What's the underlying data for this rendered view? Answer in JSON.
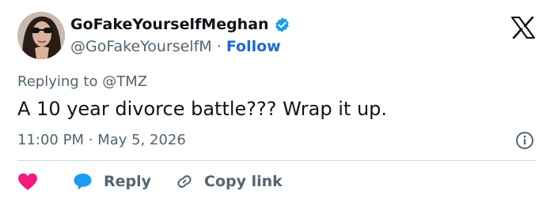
{
  "user": {
    "display_name": "GoFakeYourselfMeghan",
    "handle": "@GoFakeYourselfM",
    "separator": "·",
    "follow_label": "Follow",
    "verified_color": "#1d9bf0",
    "avatar_icon": "profile-photo"
  },
  "brand": {
    "logo_icon": "x-logo"
  },
  "tweet": {
    "reply_prefix": "Replying to",
    "reply_to": "@TMZ",
    "text": "A 10 year divorce battle??? Wrap it up.",
    "time": "11:00 PM",
    "date": "May 5, 2026",
    "time_separator": "·"
  },
  "actions": {
    "like_icon": "heart-icon",
    "like_color": "#f91880",
    "reply_label": "Reply",
    "reply_color": "#1d9bf0",
    "copy_label": "Copy link"
  }
}
